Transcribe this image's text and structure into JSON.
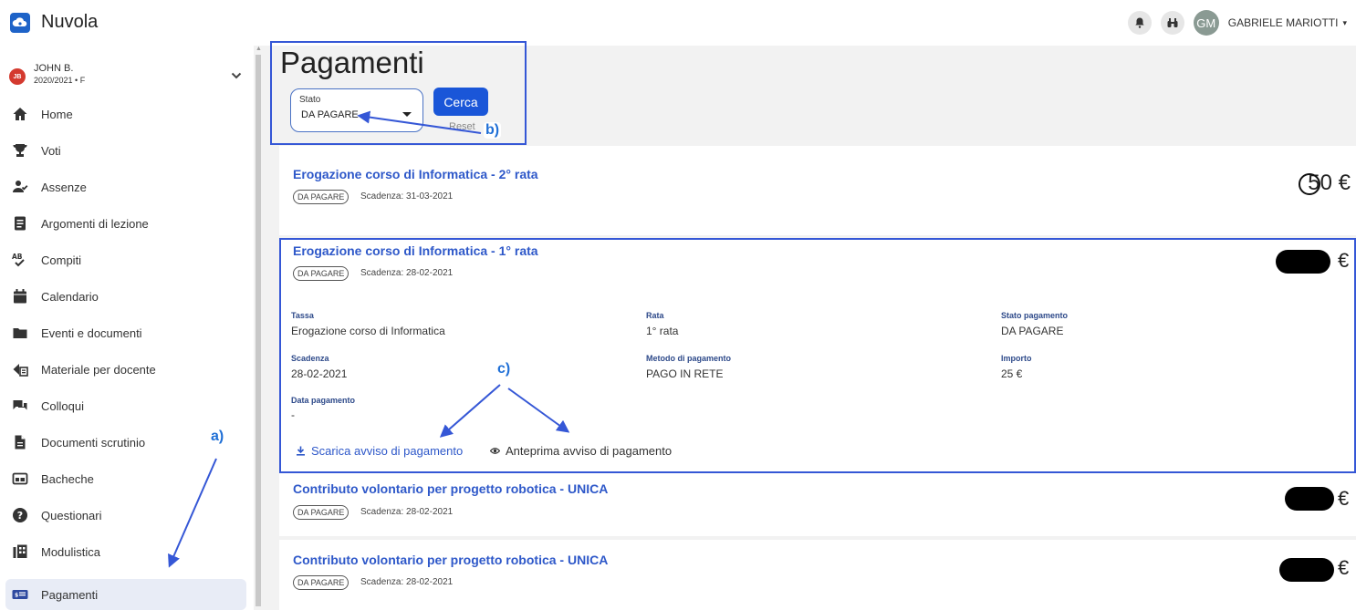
{
  "app": {
    "title": "Nuvola"
  },
  "header": {
    "user_initials": "GM",
    "user_name": "GABRIELE MARIOTTI",
    "user_caret": "▾"
  },
  "student": {
    "initials": "JB",
    "name": "JOHN B.",
    "year": "2020/2021 • F"
  },
  "sidebar": {
    "items": [
      {
        "label": "Home",
        "icon": "home-icon"
      },
      {
        "label": "Voti",
        "icon": "trophy-icon"
      },
      {
        "label": "Assenze",
        "icon": "person-check-icon"
      },
      {
        "label": "Argomenti di lezione",
        "icon": "book-icon"
      },
      {
        "label": "Compiti",
        "icon": "spellcheck-icon"
      },
      {
        "label": "Calendario",
        "icon": "calendar-icon"
      },
      {
        "label": "Eventi e documenti",
        "icon": "folder-icon"
      },
      {
        "label": "Materiale per docente",
        "icon": "teacher-material-icon"
      },
      {
        "label": "Colloqui",
        "icon": "chat-icon"
      },
      {
        "label": "Documenti scrutinio",
        "icon": "document-icon"
      },
      {
        "label": "Bacheche",
        "icon": "board-icon"
      },
      {
        "label": "Questionari",
        "icon": "help-circle-icon"
      },
      {
        "label": "Modulistica",
        "icon": "forms-icon"
      },
      {
        "label": "Pagamenti",
        "icon": "payment-icon",
        "active": true
      }
    ]
  },
  "main": {
    "title": "Pagamenti",
    "filter": {
      "label": "Stato",
      "value": "DA PAGARE",
      "search_label": "Cerca",
      "reset_label": "Reset"
    },
    "payments": [
      {
        "title": "Erogazione corso di Informatica - 2° rata",
        "status": "DA PAGARE",
        "due": "Scadenza: 31-03-2021",
        "amount": "50 €"
      },
      {
        "title": "Erogazione corso di Informatica - 1° rata",
        "status": "DA PAGARE",
        "due": "Scadenza: 28-02-2021",
        "amount_currency": "€",
        "details": {
          "tassa_label": "Tassa",
          "tassa_value": "Erogazione corso di Informatica",
          "rata_label": "Rata",
          "rata_value": "1° rata",
          "stato_label": "Stato pagamento",
          "stato_value": "DA PAGARE",
          "scadenza_label": "Scadenza",
          "scadenza_value": "28-02-2021",
          "metodo_label": "Metodo di pagamento",
          "metodo_value": "PAGO IN RETE",
          "importo_label": "Importo",
          "importo_value": "25 €",
          "data_label": "Data pagamento",
          "data_value": "-"
        },
        "actions": {
          "download_label": "Scarica avviso di pagamento",
          "preview_label": "Anteprima avviso di pagamento"
        }
      },
      {
        "title": "Contributo volontario per progetto robotica - UNICA",
        "status": "DA PAGARE",
        "due": "Scadenza: 28-02-2021",
        "amount_currency": "€"
      },
      {
        "title": "Contributo volontario per progetto robotica - UNICA",
        "status": "DA PAGARE",
        "due": "Scadenza: 28-02-2021",
        "amount_currency": "€"
      }
    ]
  },
  "annotations": {
    "a": "a)",
    "b": "b)",
    "c": "c)",
    "color": "#3557d6"
  }
}
